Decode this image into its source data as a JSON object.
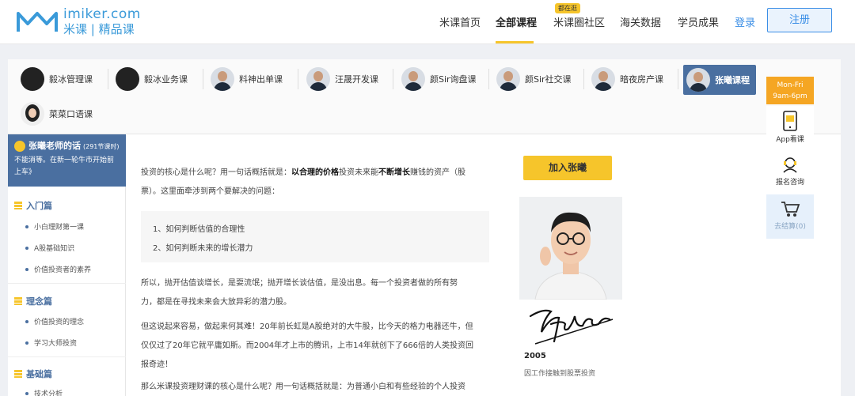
{
  "header": {
    "logo_en": "imiker.com",
    "logo_cn": "米课 | 精品课",
    "nav": [
      {
        "label": "米课首页"
      },
      {
        "label": "全部课程"
      },
      {
        "label": "米课圈社区"
      },
      {
        "label": "海关数据"
      },
      {
        "label": "学员成果"
      }
    ],
    "nav_badge": "都在逛",
    "login": "登录",
    "register": "注册"
  },
  "tabs": [
    {
      "label": "毅冰管理课"
    },
    {
      "label": "毅冰业务课"
    },
    {
      "label": "料神出单课"
    },
    {
      "label": "汪晟开发课"
    },
    {
      "label": "颜Sir询盘课"
    },
    {
      "label": "颜Sir社交课"
    },
    {
      "label": "暗夜房产课"
    },
    {
      "label": "张曦课程"
    },
    {
      "label": "菜菜口语课"
    }
  ],
  "sidebar": {
    "title": "张曦老师的话",
    "count": "(291节课时)",
    "motto": "不能消等。在新一轮牛市开始前上车》",
    "sections": [
      {
        "title": "入门篇",
        "items": [
          "小白理财第一课",
          "A股基础知识",
          "价值投资者的素养"
        ]
      },
      {
        "title": "理念篇",
        "items": [
          "价值投资的理念",
          "学习大师投资"
        ]
      },
      {
        "title": "基础篇",
        "items": [
          "技术分析"
        ]
      }
    ]
  },
  "content": {
    "p1_a": "投资的核心是什么呢？用一句话概括就是：",
    "p1_b": "以合理的价格",
    "p1_c": "投资未来能",
    "p1_d": "不断增长",
    "p1_e": "赚钱的资产（股",
    "p1_line2": "票）。这里面牵涉到两个要解决的问题：",
    "q1": "1、如何判断估值的合理性",
    "q2": "2、如何判断未来的增长潜力",
    "p2_line1": "所以，抛开估值谈增长，是耍流氓；抛开增长谈估值，是没出息。每一个投资者做的所有努",
    "p2_line2": "力，都是在寻找未来会大放异彩的潜力股。",
    "p3_line1": "但这说起来容易，做起来何其难！20年前长虹是A股绝对的大牛股，比今天的格力电器还牛，但",
    "p3_line2": "仅仅过了20年它就平庸如斯。而2004年才上市的腾讯，上市14年就创下了666倍的人类投资回",
    "p3_line3": "报奇迹！",
    "p4_line1": "那么米课投资理财课的核心是什么呢？用一句话概括就是：为普通小白和有些经验的个人投资"
  },
  "teacher": {
    "join": "加入张曦",
    "year": "2005",
    "desc": "因工作接触到股票投资"
  },
  "float": {
    "hours_line1": "Mon-Fri",
    "hours_line2": "9am-6pm",
    "app": "App看课",
    "consult": "报名咨询",
    "cart": "去结算(0)"
  },
  "colors": {
    "accent_blue": "#4a6fa0",
    "yellow": "#f6c52b",
    "link_blue": "#3a8ee6"
  }
}
